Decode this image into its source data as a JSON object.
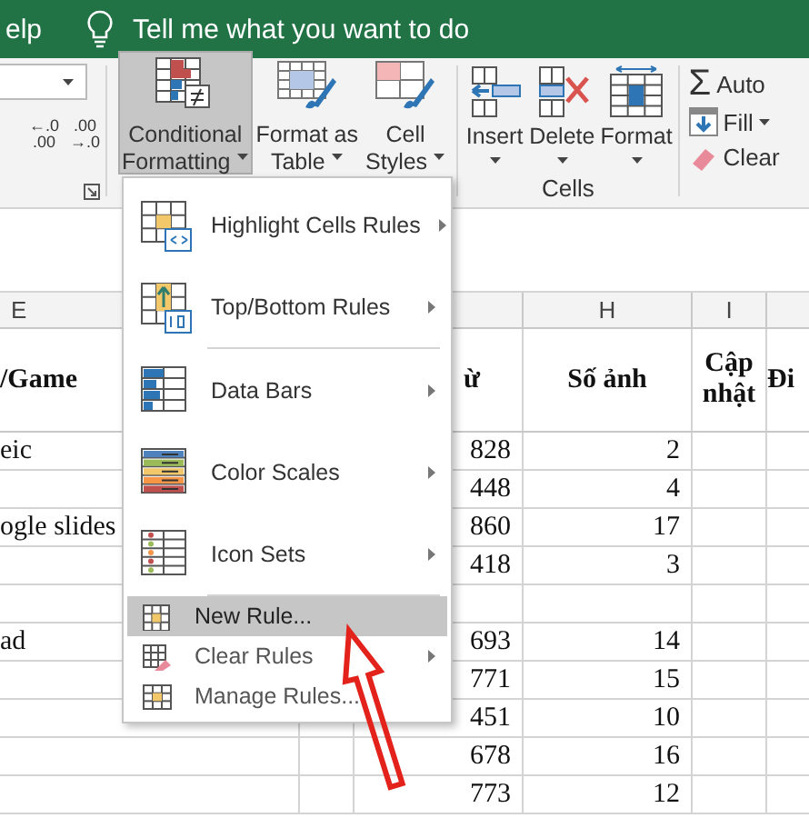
{
  "title_bar": {
    "tab_fragment": "elp",
    "tell_me": "Tell me what you want to do"
  },
  "ribbon": {
    "decimal_buttons": [
      {
        "top": "←.0",
        "bottom": ".00"
      },
      {
        "top": ".00",
        "bottom": "→.0"
      }
    ],
    "styles_commands": [
      {
        "line1": "Conditional",
        "line2": "Formatting",
        "pressed": true
      },
      {
        "line1": "Format as",
        "line2": "Table",
        "pressed": false
      },
      {
        "line1": "Cell",
        "line2": "Styles",
        "pressed": false
      }
    ],
    "cells_commands": [
      {
        "label": "Insert"
      },
      {
        "label": "Delete"
      },
      {
        "label": "Format"
      }
    ],
    "cells_group_label": "Cells",
    "editing_commands": [
      {
        "kind": "symbol",
        "symbol": "Σ",
        "label": "Auto"
      },
      {
        "kind": "fill",
        "label": "Fill"
      },
      {
        "kind": "clear",
        "label": "Clear"
      }
    ]
  },
  "sheet": {
    "column_headers": {
      "col_e": "E",
      "col_h": "H",
      "col_i": "I"
    },
    "header_row": {
      "col_e": "/Game",
      "col_g": "ừ",
      "col_h": "Số ảnh",
      "col_i": "Cập nhật",
      "col_j": "Đi"
    },
    "rows": [
      {
        "col_e": "eic",
        "col_g": "828",
        "col_h": "2"
      },
      {
        "col_g": "448",
        "col_h": "4"
      },
      {
        "col_e": "ogle slides",
        "col_g": "860",
        "col_h": "17"
      },
      {
        "col_g": "418",
        "col_h": "3"
      },
      {},
      {
        "col_e": "ad",
        "col_g": "693",
        "col_h": "14"
      },
      {
        "col_g": "771",
        "col_h": "15"
      },
      {
        "col_g": "451",
        "col_h": "10"
      },
      {
        "col_g": "678",
        "col_h": "16"
      },
      {
        "col_g": "773",
        "col_h": "12"
      }
    ]
  },
  "menu": {
    "items": [
      {
        "kind": "large",
        "label": "Highlight Cells Rules",
        "submenu": true,
        "selected": false
      },
      {
        "kind": "large",
        "label": "Top/Bottom Rules",
        "submenu": true,
        "selected": false
      },
      {
        "kind": "separator"
      },
      {
        "kind": "large",
        "label": "Data Bars",
        "submenu": true,
        "selected": false
      },
      {
        "kind": "large",
        "label": "Color Scales",
        "submenu": true,
        "selected": false
      },
      {
        "kind": "large",
        "label": "Icon Sets",
        "submenu": true,
        "selected": false
      },
      {
        "kind": "separator"
      },
      {
        "kind": "small",
        "label": "New Rule...",
        "submenu": false,
        "selected": true
      },
      {
        "kind": "small",
        "label": "Clear Rules",
        "submenu": true,
        "selected": false
      },
      {
        "kind": "small",
        "label": "Manage Rules...",
        "submenu": false,
        "selected": false
      }
    ]
  },
  "annotation": {
    "kind": "arrow"
  }
}
